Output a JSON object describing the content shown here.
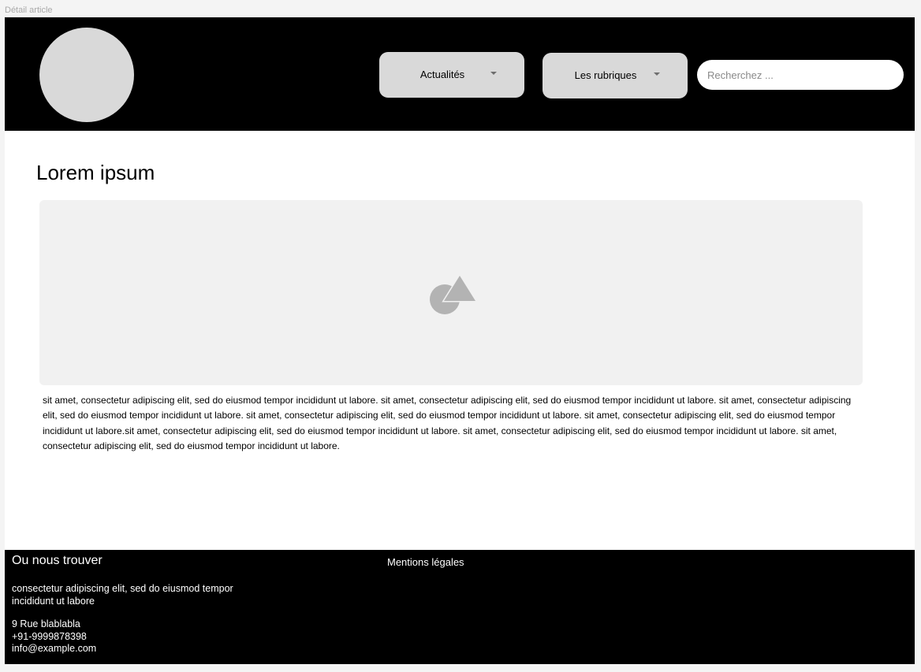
{
  "frame": {
    "label": "Détail article"
  },
  "header": {
    "nav": {
      "actualites_label": "Actualités",
      "rubriques_label": "Les rubriques"
    },
    "search": {
      "placeholder": "Recherchez ...",
      "value": ""
    }
  },
  "main": {
    "title": "Lorem ipsum",
    "image_icon": "image-placeholder-icon",
    "body": "sit amet, consectetur adipiscing elit, sed do eiusmod tempor incididunt ut labore. sit amet, consectetur adipiscing elit, sed do eiusmod tempor incididunt ut labore. sit amet, consectetur adipiscing elit, sed do eiusmod tempor incididunt ut labore. sit amet, consectetur adipiscing elit, sed do eiusmod tempor incididunt ut labore. sit amet, consectetur adipiscing elit, sed do eiusmod tempor incididunt ut labore.sit amet, consectetur adipiscing elit, sed do eiusmod tempor incididunt ut labore. sit amet, consectetur adipiscing elit, sed do eiusmod tempor incididunt ut labore. sit amet, consectetur adipiscing elit, sed do eiusmod tempor incididunt ut labore."
  },
  "footer": {
    "title": "Ou nous trouver",
    "description": "consectetur adipiscing elit, sed do eiusmod tempor incididunt ut labore",
    "address": "9 Rue blablabla",
    "phone": "+91-9999878398",
    "email": "info@example.com",
    "legal_label": "Mentions légales"
  },
  "colors": {
    "header_bg": "#000000",
    "footer_bg": "#000000",
    "placeholder_gray": "#d9d9d9",
    "image_bg": "#f1f1f1"
  }
}
